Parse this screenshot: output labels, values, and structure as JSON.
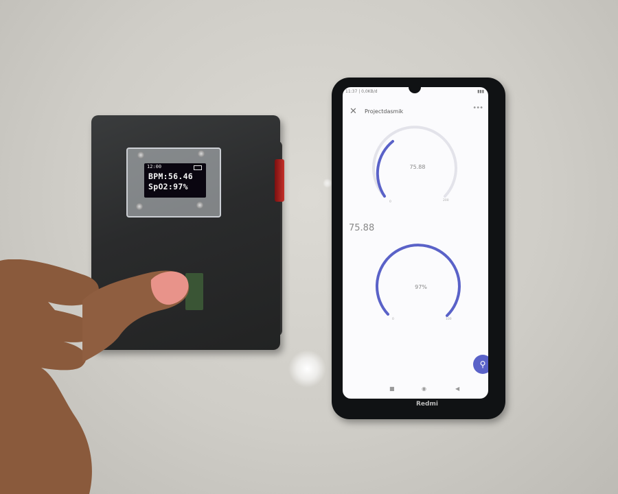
{
  "oled": {
    "top_left": "12:00",
    "line1": "BPM:56.46",
    "line2": "SpO2:97%"
  },
  "phone": {
    "status_left": "11:37 | 0,0KB/d",
    "status_right": "",
    "app_title": "Projectdasmik",
    "more_icon": "•••",
    "close_icon": "✕",
    "gauge1": {
      "value_text": "75.88",
      "min_text": "0",
      "max_text": "200",
      "fraction": 0.3
    },
    "gauge2": {
      "value_text": "97%",
      "min_text": "0",
      "max_text": "100",
      "fraction": 0.97
    },
    "side_readout": "75.88",
    "brand": "Redmi",
    "fab_icon": "key-icon",
    "nav": [
      "■",
      "◉",
      "◀"
    ]
  },
  "colors": {
    "accent": "#5a62c8",
    "track": "#e3e3ea"
  }
}
